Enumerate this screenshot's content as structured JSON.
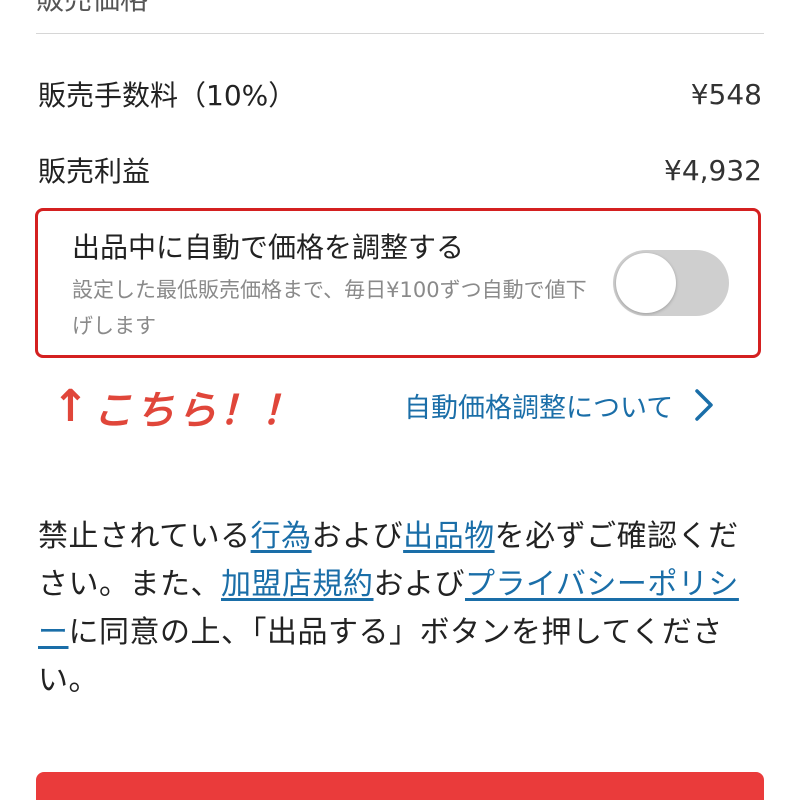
{
  "top_cut_text": "販売価格",
  "fee_row": {
    "label": "販売手数料（10%）",
    "value": "¥548"
  },
  "profit_row": {
    "label": "販売利益",
    "value": "¥4,932"
  },
  "auto_price": {
    "title": "出品中に自動で価格を調整する",
    "description": "設定した最低販売価格まで、毎日¥100ずつ自動で値下げします",
    "enabled": false
  },
  "annotation": {
    "arrow": "↑",
    "text": "こちら！！",
    "color": "#e0463a"
  },
  "about_link": {
    "label": "自動価格調整について"
  },
  "notice": {
    "t1": "禁止されている",
    "link_acts": "行為",
    "t2": "および",
    "link_items": "出品物",
    "t3": "を必ずご確認ください。また、",
    "link_terms": "加盟店規約",
    "t4": "および",
    "link_privacy": "プライバシーポリシー",
    "t5": "に同意の上、「出品する」ボタンを押してください。"
  },
  "colors": {
    "highlight_border": "#d42020",
    "link": "#1a6ea8",
    "toggle_off": "#cfcfcf",
    "submit_button": "#ea3b3b"
  }
}
